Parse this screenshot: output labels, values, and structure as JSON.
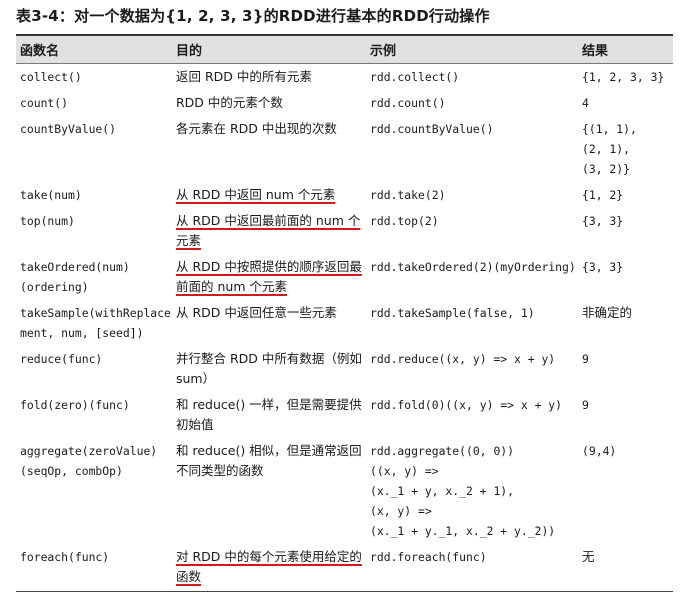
{
  "caption": "表3-4：对一个数据为{1, 2, 3, 3}的RDD进行基本的RDD行动操作",
  "headers": [
    "函数名",
    "目的",
    "示例",
    "结果"
  ],
  "rows": [
    {
      "name": [
        "collect()"
      ],
      "purpose": "返回 RDD 中的所有元素",
      "example": [
        "rdd.collect()"
      ],
      "result": [
        "{1, 2, 3, 3}"
      ]
    },
    {
      "name": [
        "count()"
      ],
      "purpose": "RDD 中的元素个数",
      "example": [
        "rdd.count()"
      ],
      "result": [
        "4"
      ]
    },
    {
      "name": [
        "countByValue()"
      ],
      "purpose": "各元素在 RDD 中出现的次数",
      "example": [
        "rdd.countByValue()"
      ],
      "result": [
        "{(1, 1),",
        "(2, 1),",
        "(3, 2)}"
      ]
    },
    {
      "name": [
        "take(num)"
      ],
      "purpose": "从 RDD 中返回 num 个元素",
      "example": [
        "rdd.take(2)"
      ],
      "result": [
        "{1, 2}"
      ]
    },
    {
      "name": [
        "top(num)"
      ],
      "purpose": "从 RDD 中返回最前面的 num 个元素",
      "example": [
        "rdd.top(2)"
      ],
      "result": [
        "{3, 3}"
      ]
    },
    {
      "name": [
        "takeOrdered(num)",
        "(ordering)"
      ],
      "purpose": "从 RDD 中按照提供的顺序返回最前面的 num 个元素",
      "example": [
        "rdd.takeOrdered(2)(myOrdering)"
      ],
      "result": [
        "{3, 3}"
      ]
    },
    {
      "name": [
        "takeSample(withReplace",
        "ment, num, [seed])"
      ],
      "purpose": "从 RDD 中返回任意一些元素",
      "example": [
        "rdd.takeSample(false, 1)"
      ],
      "result": [
        "非确定的"
      ]
    },
    {
      "name": [
        "reduce(func)"
      ],
      "purpose": "并行整合 RDD 中所有数据（例如 sum）",
      "example": [
        "rdd.reduce((x, y) => x + y)"
      ],
      "result": [
        "9"
      ]
    },
    {
      "name": [
        "fold(zero)(func)"
      ],
      "purpose": "和 reduce() 一样，但是需要提供初始值",
      "example": [
        "rdd.fold(0)((x, y) => x + y)"
      ],
      "result": [
        "9"
      ]
    },
    {
      "name": [
        "aggregate(zeroValue)",
        "(seqOp, combOp)"
      ],
      "purpose": "和 reduce() 相似，但是通常返回不同类型的函数",
      "example": [
        "rdd.aggregate((0, 0))",
        "((x, y) =>",
        "(x._1 + y, x._2 + 1),",
        "(x, y) =>",
        "(x._1 + y._1, x._2 + y._2))"
      ],
      "result": [
        "(9,4)"
      ]
    },
    {
      "name": [
        "foreach(func)"
      ],
      "purpose": "对 RDD 中的每个元素使用给定的函数",
      "example": [
        "rdd.foreach(func)"
      ],
      "result": [
        "无"
      ]
    }
  ],
  "underlined_rows": [
    3,
    4,
    5,
    10
  ],
  "colors": {
    "header_bg": "#e1e1e1",
    "underline": "#d01b1b",
    "text": "#1a1a1a"
  }
}
